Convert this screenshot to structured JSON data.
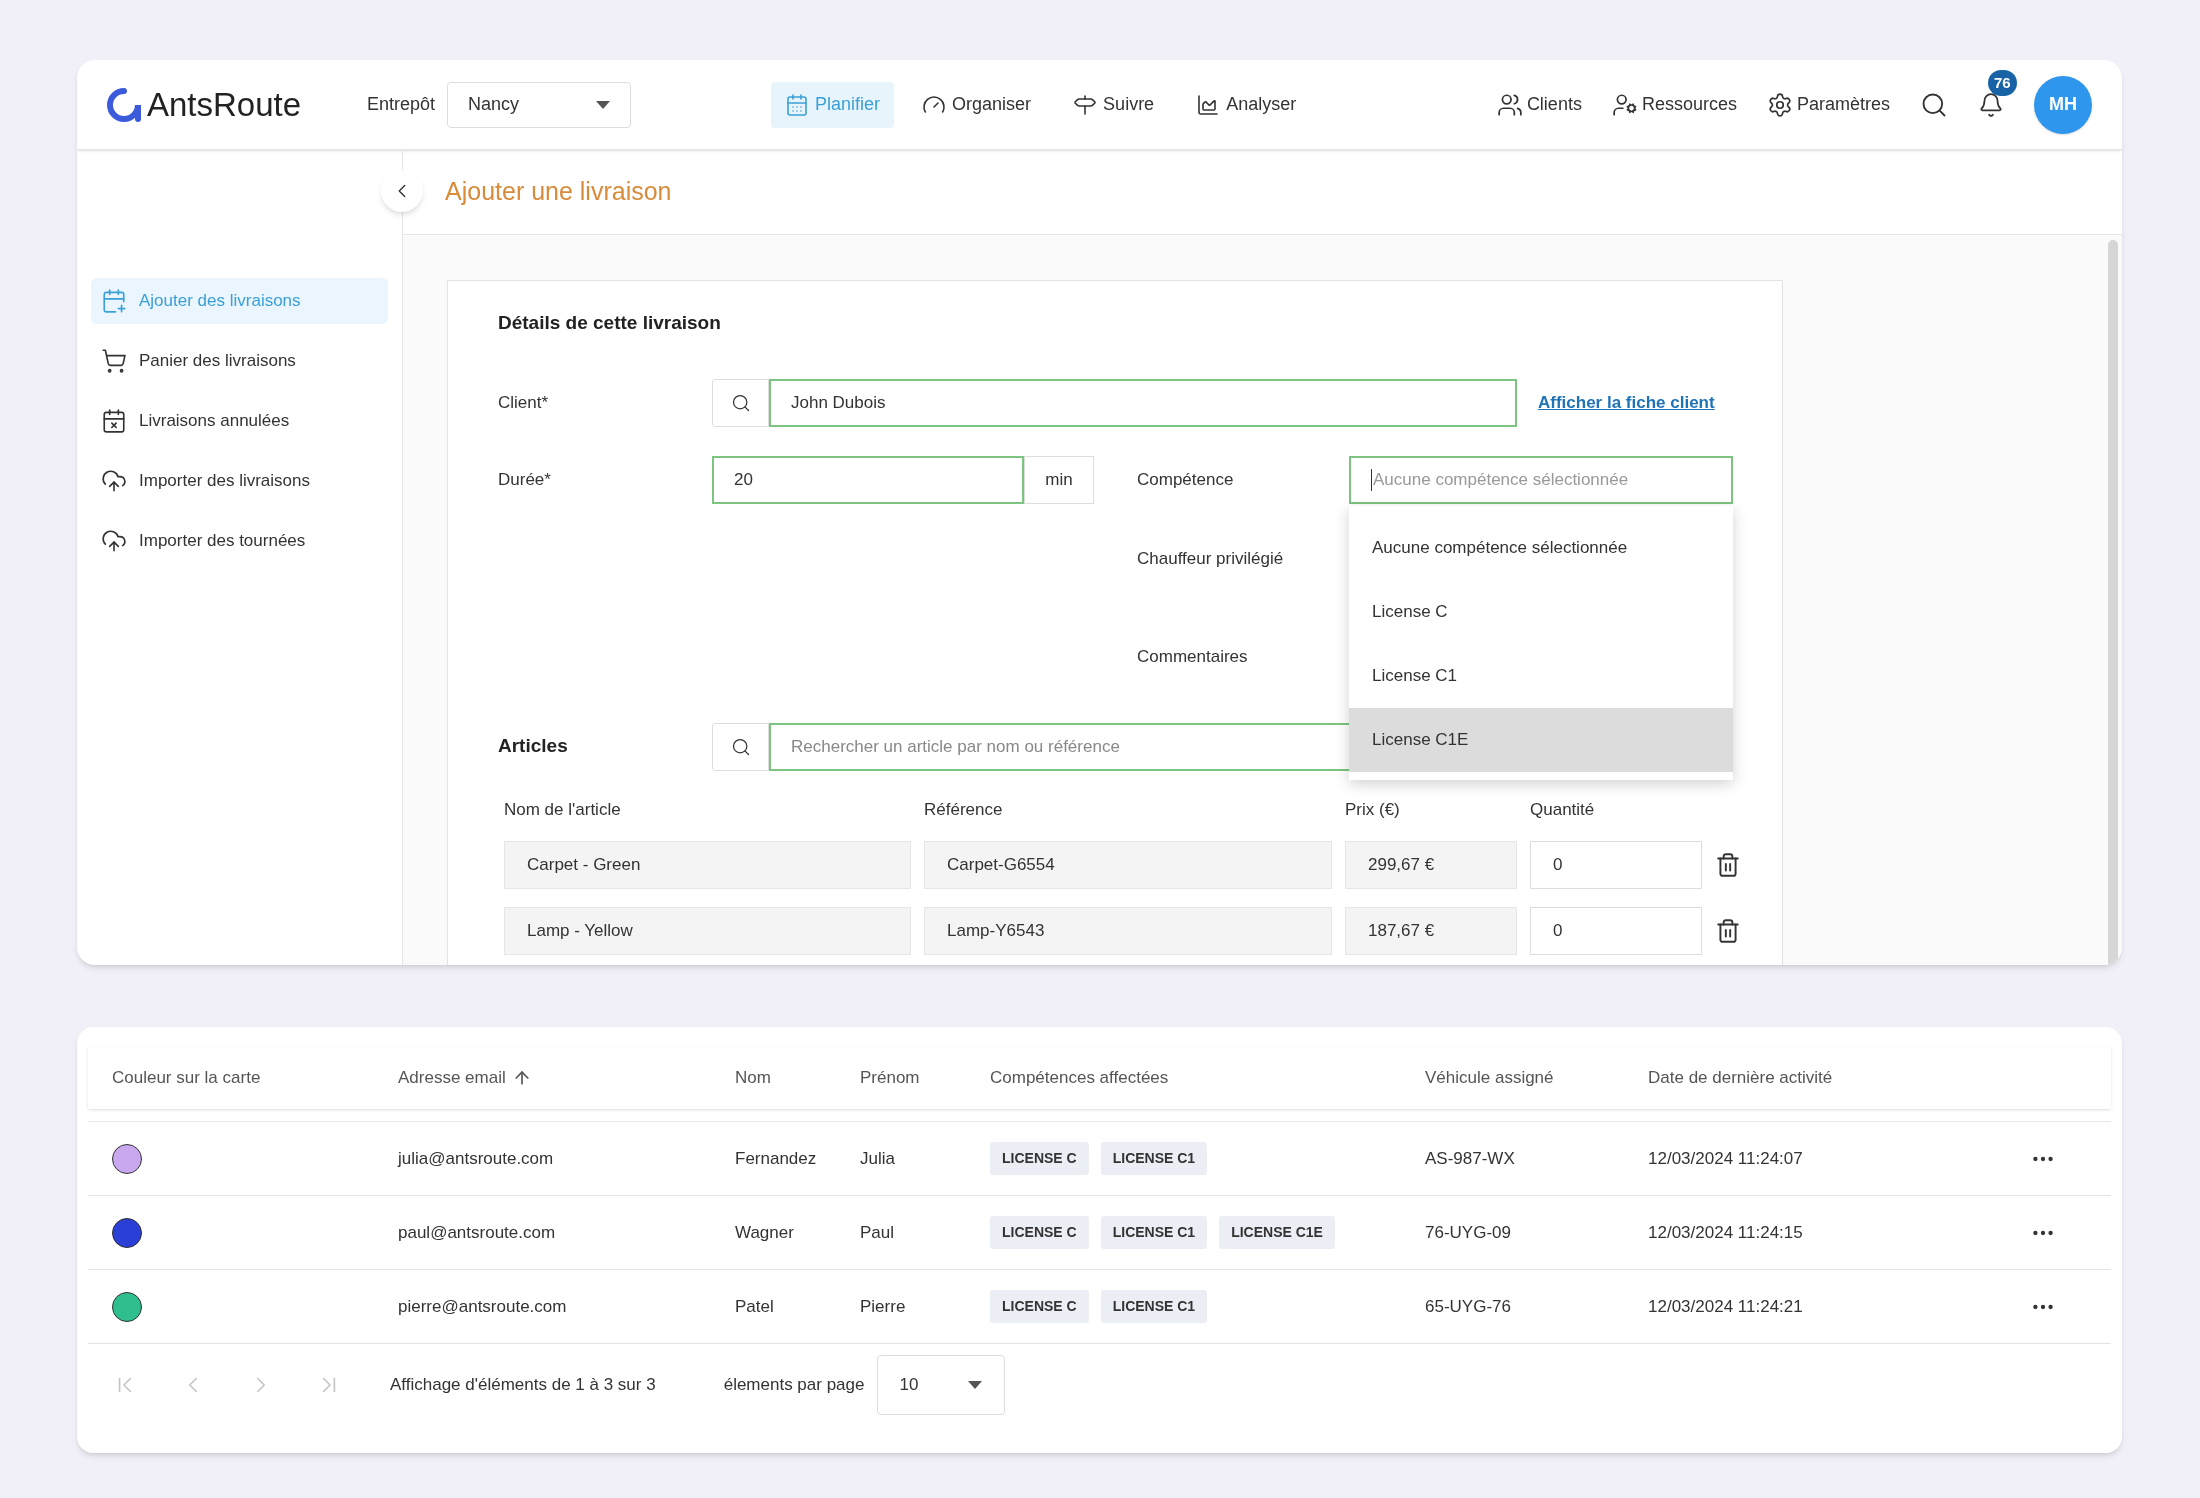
{
  "header": {
    "logo": "AntsRoute",
    "warehouse_label": "Entrepôt",
    "warehouse": "Nancy",
    "nav": [
      {
        "label": "Planifier",
        "selected": true
      },
      {
        "label": "Organiser",
        "selected": false
      },
      {
        "label": "Suivre",
        "selected": false
      },
      {
        "label": "Analyser",
        "selected": false
      }
    ],
    "right_nav": [
      "Clients",
      "Ressources",
      "Paramètres"
    ],
    "notifications": "76",
    "avatar": "MH"
  },
  "sidebar": {
    "items": [
      {
        "label": "Ajouter des livraisons",
        "selected": true
      },
      {
        "label": "Panier des livraisons",
        "selected": false
      },
      {
        "label": "Livraisons annulées",
        "selected": false
      },
      {
        "label": "Importer des livraisons",
        "selected": false
      },
      {
        "label": "Importer des tournées",
        "selected": false
      }
    ]
  },
  "page_title": "Ajouter une livraison",
  "form": {
    "title": "Détails de cette livraison",
    "client_label": "Client*",
    "client": "John Dubois",
    "client_link": "Afficher la fiche client",
    "duration_label": "Durée*",
    "duration": "20",
    "duration_unit": "min",
    "skill_label": "Compétence",
    "skill_placeholder": "Aucune compétence sélectionnée",
    "skill_options": [
      {
        "label": "Aucune compétence sélectionnée",
        "highlighted": false
      },
      {
        "label": "License C",
        "highlighted": false
      },
      {
        "label": "License C1",
        "highlighted": false
      },
      {
        "label": "License C1E",
        "highlighted": true
      }
    ],
    "driver_label": "Chauffeur privilégié",
    "comments_label": "Commentaires",
    "articles_label": "Articles",
    "article_search_placeholder": "Rechercher un article par nom ou référence",
    "article_columns": [
      "Nom de l'article",
      "Référence",
      "Prix (€)",
      "Quantité"
    ],
    "articles": [
      {
        "name": "Carpet - Green",
        "reference": "Carpet-G6554",
        "price": "299,67 €",
        "quantity": "0"
      },
      {
        "name": "Lamp - Yellow",
        "reference": "Lamp-Y6543",
        "price": "187,67 €",
        "quantity": "0"
      }
    ]
  },
  "drivers_table": {
    "columns": [
      {
        "label": "Couleur sur la carte",
        "sorted": false
      },
      {
        "label": "Adresse email",
        "sorted": true
      },
      {
        "label": "Nom",
        "sorted": false
      },
      {
        "label": "Prénom",
        "sorted": false
      },
      {
        "label": "Compétences affectées",
        "sorted": false
      },
      {
        "label": "Véhicule assigné",
        "sorted": false
      },
      {
        "label": "Date de dernière activité",
        "sorted": false
      }
    ],
    "rows": [
      {
        "color": "#c9a8f0",
        "email": "julia@antsroute.com",
        "last_name": "Fernandez",
        "first_name": "Julia",
        "skills": [
          "LICENSE C",
          "LICENSE C1"
        ],
        "vehicle": "AS-987-WX",
        "last_activity": "12/03/2024 11:24:07"
      },
      {
        "color": "#2a3fd6",
        "email": "paul@antsroute.com",
        "last_name": "Wagner",
        "first_name": "Paul",
        "skills": [
          "LICENSE C",
          "LICENSE C1",
          "LICENSE C1E"
        ],
        "vehicle": "76-UYG-09",
        "last_activity": "12/03/2024 11:24:15"
      },
      {
        "color": "#2fbf8f",
        "email": "pierre@antsroute.com",
        "last_name": "Patel",
        "first_name": "Pierre",
        "skills": [
          "LICENSE C",
          "LICENSE C1"
        ],
        "vehicle": "65-UYG-76",
        "last_activity": "12/03/2024 11:24:21"
      }
    ],
    "pagination": {
      "nav_disabled": true,
      "summary": "Affichage d'éléments de 1 à 3 sur 3",
      "per_page_label": "élements par page",
      "per_page": "10"
    }
  }
}
